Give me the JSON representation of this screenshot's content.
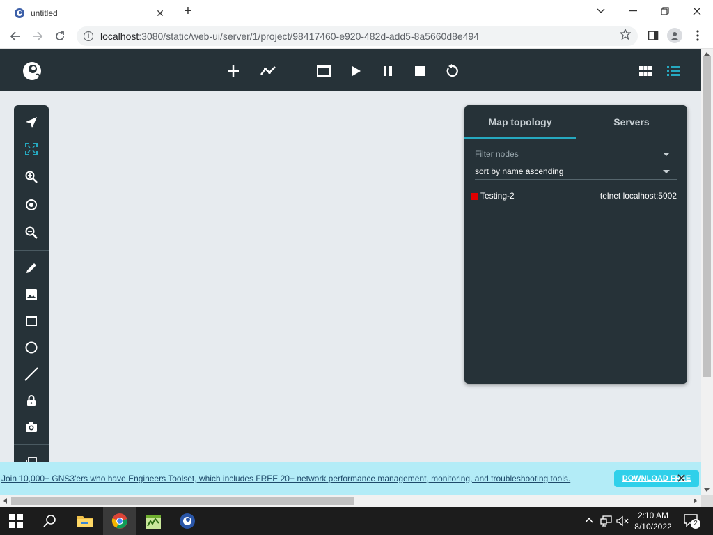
{
  "browser": {
    "tab_title": "untitled",
    "new_tab": "+",
    "tab_close": "✕",
    "url_host": "localhost",
    "url_path": ":3080/static/web-ui/server/1/project/98417460-e920-482d-add5-8a5660d8e494"
  },
  "right_panel": {
    "tabs": [
      "Map topology",
      "Servers"
    ],
    "active_tab": "Map topology",
    "filter_label": "Filter nodes",
    "sort_value": "sort by name ascending",
    "nodes": [
      {
        "name": "Testing-2",
        "console": "telnet localhost:5002",
        "status_color": "#e00000"
      }
    ]
  },
  "ad": {
    "text": "Join 10,000+ GNS3'ers who have Engineers Toolset, which includes FREE 20+ network performance management, monitoring, and troubleshooting tools.",
    "button": "DOWNLOAD FREE",
    "close": "✕"
  },
  "taskbar": {
    "time": "2:10 AM",
    "date": "8/10/2022",
    "notification_count": "2"
  },
  "colors": {
    "toolbar_bg": "#263238",
    "canvas_bg": "#e7ebef",
    "accent": "#26a9c0",
    "ad_bg": "#b3ecf7"
  }
}
